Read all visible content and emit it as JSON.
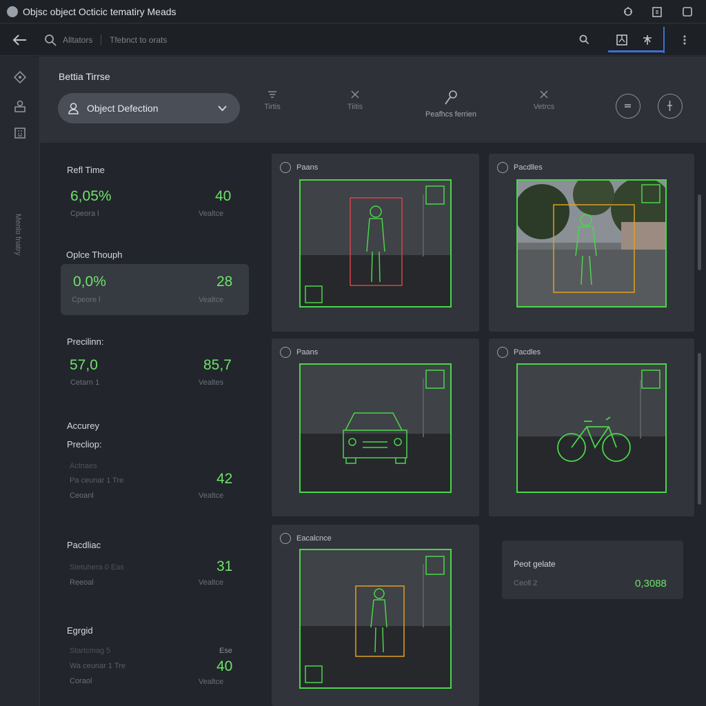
{
  "window": {
    "title": "Objsc object Octicic tematiry Meads"
  },
  "toolbar": {
    "crumb_1": "Alltators",
    "crumb_2": "Tfebnct to orats"
  },
  "header": {
    "section_title": "Bettia Tirrse",
    "dropdown_label": "Object Defection",
    "tools": [
      {
        "label": "Tirtis",
        "icon": "filter-icon"
      },
      {
        "label": "Tiitis",
        "icon": "close-icon"
      },
      {
        "label": "Peafhcs ferrien",
        "icon": "link-icon"
      },
      {
        "label": "Vetrcs",
        "icon": "close-icon"
      }
    ]
  },
  "metrics": {
    "realtime": {
      "label": "Refl Time",
      "left_value": "6,05%",
      "right_value": "40",
      "left_sub": "Cpeora l",
      "right_sub": "Vealtce"
    },
    "opl": {
      "label": "Oplce Thouph",
      "left_value": "0,0%",
      "right_value": "28",
      "left_sub": "Cpeore l",
      "right_sub": "Vealtce"
    },
    "precision": {
      "label": "Precilinn:",
      "left_value": "57,0",
      "right_value": "85,7",
      "left_sub": "Cetarn 1",
      "right_sub": "Vealtes"
    },
    "accuracy": {
      "label_1": "Accurey",
      "label_2": "Precliop:",
      "sub_1": "Actnaes",
      "sub_2": "Pa ceunar 1 Tre",
      "sub_3": "Ceoanl",
      "value": "42",
      "value_sub": "Vealtce"
    },
    "paclias": {
      "label": "Pacdliac",
      "sub_1": "Stetuhera 0 Eas",
      "sub_2": "Reeoal",
      "value": "31",
      "value_sub": "Vealtce"
    },
    "egrid": {
      "label": "Egrgid",
      "sub_1": "Startcmag 5",
      "sub_2": "Wa ceunar 1 Tre",
      "sub_3": "Coraol",
      "value_top": "Ese",
      "value": "40",
      "value_sub": "Vealtce"
    }
  },
  "detections": [
    {
      "title": "Paans",
      "object": "person"
    },
    {
      "title": "Pacdlles",
      "object": "person-street"
    },
    {
      "title": "Paans",
      "object": "car"
    },
    {
      "title": "Pacdles",
      "object": "bicycle"
    },
    {
      "title": "Eacalcnce",
      "object": "person"
    }
  ],
  "score": {
    "label": "Peot gelate",
    "sub": "Ceoll 2",
    "value": "0,3088"
  },
  "colors": {
    "accent_green": "#4bd64a",
    "box_red": "#d64545",
    "box_orange": "#e0a020",
    "highlight_blue": "#3d6fd6"
  }
}
